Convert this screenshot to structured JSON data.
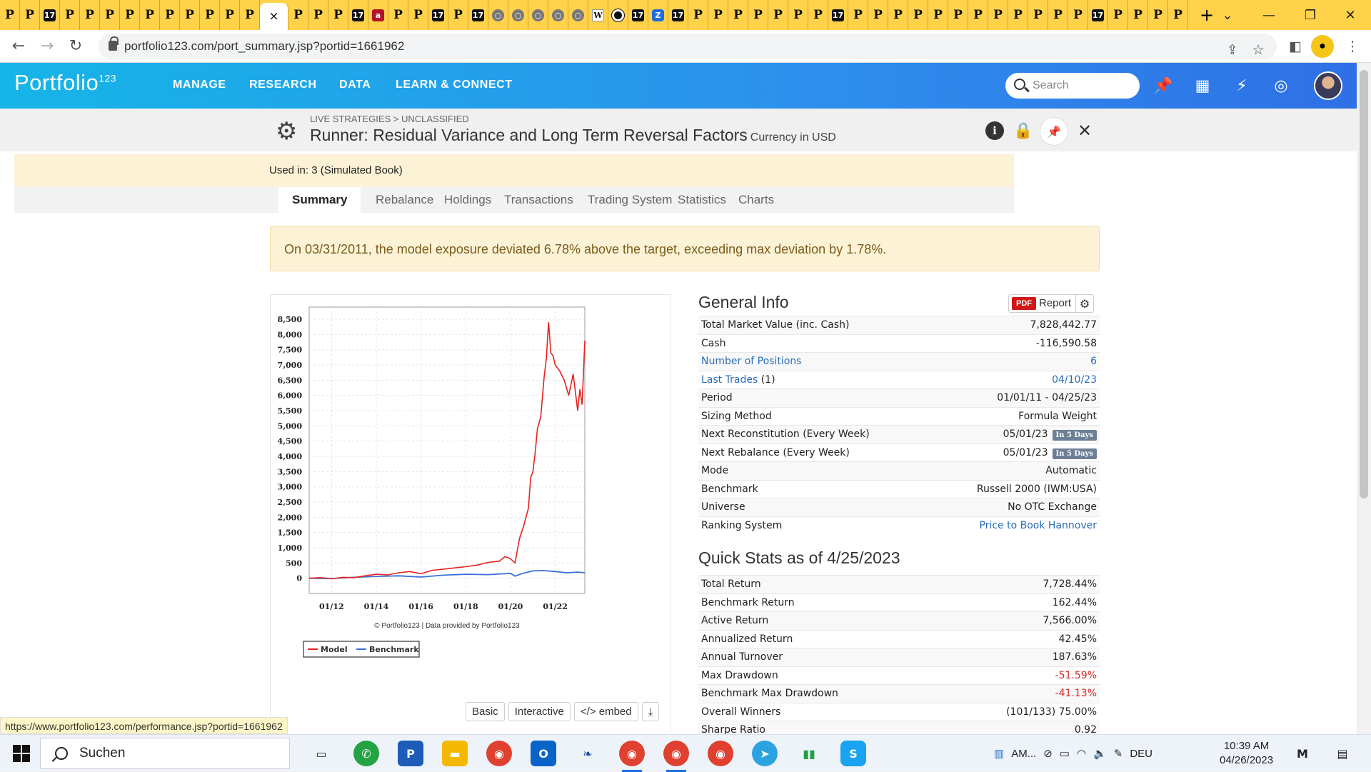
{
  "browser": {
    "tabs": [
      "P",
      "P",
      "17",
      "P",
      "P",
      "P",
      "P",
      "P",
      "P",
      "P",
      "P",
      "P",
      "P",
      "×",
      "P",
      "P",
      "P",
      "17",
      "a",
      "P",
      "P",
      "17",
      "P",
      "17",
      "○",
      "○",
      "○",
      "○",
      "○",
      "W",
      "●",
      "17",
      "Z",
      "17",
      "P",
      "P",
      "P",
      "P",
      "P",
      "P",
      "P",
      "17",
      "P",
      "P",
      "P",
      "P",
      "P",
      "P",
      "P",
      "P",
      "P",
      "P",
      "P",
      "P",
      "17",
      "P",
      "P",
      "P",
      "P"
    ],
    "new_tab": "+",
    "url": "portfolio123.com/port_summary.jsp?portid=1661962",
    "status_url": "https://www.portfolio123.com/performance.jsp?portid=1661962"
  },
  "app": {
    "logo": "Portfolio",
    "logo_sup": "123",
    "nav": [
      "MANAGE",
      "RESEARCH",
      "DATA",
      "LEARN & CONNECT"
    ],
    "search_placeholder": "Search"
  },
  "header": {
    "breadcrumb": "LIVE STRATEGIES > UNCLASSIFIED",
    "title": "Runner: Residual Variance and Long Term Reversal Factors",
    "currency": "Currency in USD",
    "used_in": "Used in: 3 (Simulated Book)"
  },
  "tabs": [
    "Summary",
    "Rebalance",
    "Holdings",
    "Transactions",
    "Trading System",
    "Statistics",
    "Charts"
  ],
  "alert": "On 03/31/2011, the model exposure deviated 6.78% above the target, exceeding max deviation by 1.78%.",
  "chart_buttons": {
    "basic": "Basic",
    "interactive": "Interactive",
    "embed": "</> embed"
  },
  "general_info": {
    "title": "General Info",
    "pdf_badge": "PDF",
    "report": "Report",
    "rows": [
      {
        "label": "Total Market Value (inc. Cash)",
        "value": "7,828,442.77"
      },
      {
        "label": "Cash",
        "value": "-116,590.58"
      },
      {
        "label": "Number of Positions",
        "value": "6"
      },
      {
        "label": "Last Trades",
        "count": "(1)",
        "value": "04/10/23"
      },
      {
        "label": "Period",
        "value": "01/01/11 - 04/25/23"
      },
      {
        "label": "Sizing Method",
        "value": "Formula Weight"
      },
      {
        "label": "Next Reconstitution (Every Week)",
        "value": "05/01/23",
        "badge": "In 5 Days"
      },
      {
        "label": "Next Rebalance (Every Week)",
        "value": "05/01/23",
        "badge": "In 5 Days"
      },
      {
        "label": "Mode",
        "value": "Automatic"
      },
      {
        "label": "Benchmark",
        "value": "Russell 2000 (IWM:USA)"
      },
      {
        "label": "Universe",
        "value": "No OTC Exchange"
      },
      {
        "label": "Ranking System",
        "value": "Price to Book Hannover"
      }
    ]
  },
  "quick_stats": {
    "title": "Quick Stats as of 4/25/2023",
    "rows": [
      {
        "label": "Total Return",
        "value": "7,728.44%"
      },
      {
        "label": "Benchmark Return",
        "value": "162.44%"
      },
      {
        "label": "Active Return",
        "value": "7,566.00%"
      },
      {
        "label": "Annualized Return",
        "value": "42.45%"
      },
      {
        "label": "Annual Turnover",
        "value": "187.63%"
      },
      {
        "label": "Max Drawdown",
        "value": "-51.59%"
      },
      {
        "label": "Benchmark Max Drawdown",
        "value": "-41.13%"
      },
      {
        "label": "Overall Winners",
        "value": "(101/133) 75.00%"
      },
      {
        "label": "Sharpe Ratio",
        "value": "0.92"
      }
    ]
  },
  "chart_data": {
    "type": "line",
    "yticks": [
      "8,500",
      "8,000",
      "7,500",
      "7,000",
      "6,500",
      "6,000",
      "5,500",
      "5,000",
      "4,500",
      "4,000",
      "3,500",
      "3,000",
      "2,500",
      "2,000",
      "1,500",
      "1,000",
      "500",
      "0"
    ],
    "xticks": [
      "01/12",
      "01/14",
      "01/16",
      "01/18",
      "01/20",
      "01/22"
    ],
    "ylim": [
      -500,
      8900
    ],
    "xlim": [
      2011.0,
      2023.32
    ],
    "credit": "© Portfolio123 | Data provided by Portfolio123",
    "legend": [
      "Model",
      "Benchmark"
    ],
    "colors": {
      "Model": "#e8221f",
      "Benchmark": "#3b6fd6"
    },
    "series": [
      {
        "name": "Model",
        "x": [
          2011.0,
          2011.5,
          2012.0,
          2012.5,
          2013.0,
          2013.5,
          2014.0,
          2014.5,
          2015.0,
          2015.5,
          2016.0,
          2016.5,
          2017.0,
          2017.5,
          2018.0,
          2018.5,
          2019.0,
          2019.5,
          2019.75,
          2020.0,
          2020.2,
          2020.4,
          2020.6,
          2020.8,
          2020.9,
          2021.0,
          2021.1,
          2021.2,
          2021.35,
          2021.5,
          2021.6,
          2021.7,
          2021.8,
          2021.9,
          2022.0,
          2022.2,
          2022.4,
          2022.6,
          2022.8,
          2023.0,
          2023.1,
          2023.2,
          2023.32
        ],
        "y": [
          0,
          20,
          -20,
          30,
          20,
          80,
          130,
          110,
          180,
          220,
          150,
          260,
          300,
          340,
          380,
          430,
          520,
          560,
          710,
          640,
          500,
          1300,
          1750,
          2300,
          3300,
          3500,
          4100,
          4900,
          5300,
          6600,
          7200,
          8400,
          7400,
          7300,
          7000,
          6800,
          6500,
          6000,
          6700,
          5500,
          6200,
          5700,
          7800
        ]
      },
      {
        "name": "Benchmark",
        "x": [
          2011.0,
          2012.0,
          2013.0,
          2014.0,
          2015.0,
          2016.0,
          2017.0,
          2018.0,
          2019.0,
          2020.0,
          2020.2,
          2020.5,
          2021.0,
          2021.5,
          2022.0,
          2022.5,
          2023.0,
          2023.32
        ],
        "y": [
          0,
          -10,
          30,
          60,
          80,
          40,
          100,
          130,
          120,
          160,
          70,
          150,
          240,
          250,
          220,
          180,
          200,
          180
        ]
      }
    ]
  }
}
